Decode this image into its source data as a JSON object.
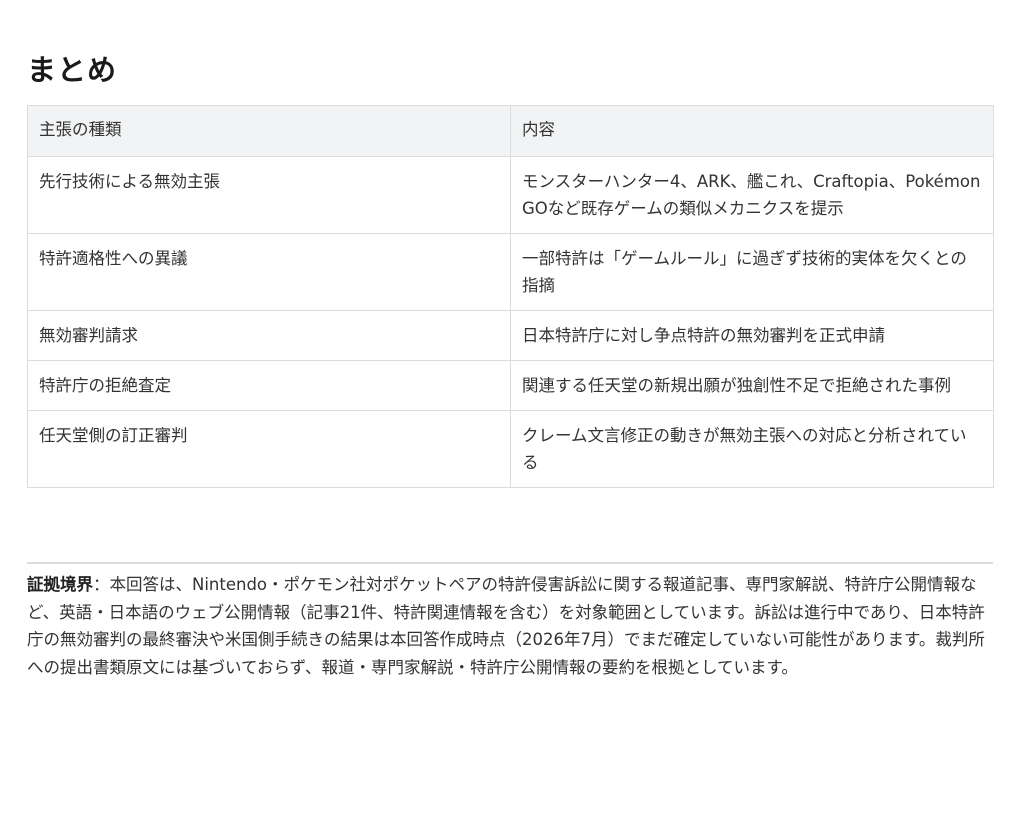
{
  "title": "まとめ",
  "table": {
    "headers": [
      "主張の種類",
      "内容"
    ],
    "rows": [
      [
        "先行技術による無効主張",
        "モンスターハンター4、ARK、艦これ、Craftopia、Pokémon GOなど既存ゲームの類似メカニクスを提示"
      ],
      [
        "特許適格性への異議",
        "一部特許は「ゲームルール」に過ぎず技術的実体を欠くとの指摘"
      ],
      [
        "無効審判請求",
        "日本特許庁に対し争点特許の無効審判を正式申請"
      ],
      [
        "特許庁の拒絶査定",
        "関連する任天堂の新規出願が独創性不足で拒絶された事例"
      ],
      [
        "任天堂側の訂正審判",
        "クレーム文言修正の動きが無効主張への対応と分析されている"
      ]
    ]
  },
  "evidence": {
    "label": "証拠境界",
    "separator": "：",
    "text": "本回答は、Nintendo・ポケモン社対ポケットペアの特許侵害訴訟に関する報道記事、専門家解説、特許庁公開情報など、英語・日本語のウェブ公開情報（記事21件、特許関連情報を含む）を対象範囲としています。訴訟は進行中であり、日本特許庁の無効審判の最終審決や米国側手続きの結果は本回答作成時点（2026年7月）でまだ確定していない可能性があります。裁判所への提出書類原文には基づいておらず、報道・専門家解説・特許庁公開情報の要約を根拠としています。"
  }
}
